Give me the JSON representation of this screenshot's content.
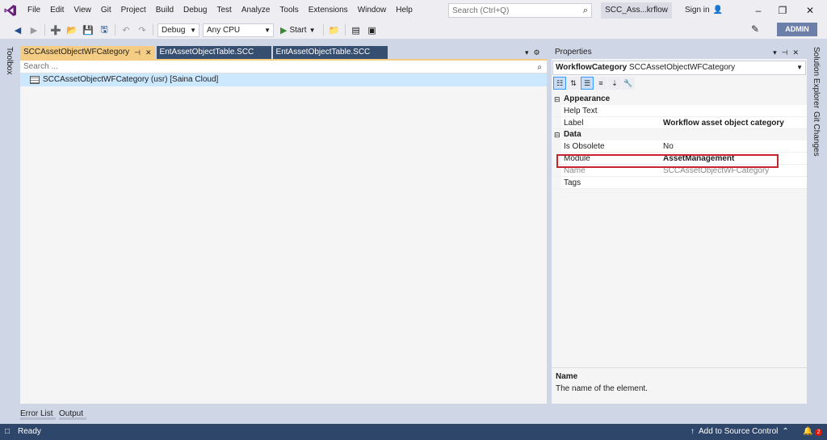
{
  "menubar": {
    "items": [
      "File",
      "Edit",
      "View",
      "Git",
      "Project",
      "Build",
      "Debug",
      "Test",
      "Analyze",
      "Tools",
      "Extensions",
      "Window",
      "Help"
    ],
    "search_placeholder": "Search (Ctrl+Q)",
    "solution_title": "SCC_Ass...krflow",
    "sign_in": "Sign in"
  },
  "toolbar": {
    "config": "Debug",
    "platform": "Any CPU",
    "start": "Start",
    "admin": "ADMIN"
  },
  "side": {
    "toolbox": "Toolbox",
    "solution_explorer": "Solution Explorer",
    "git_changes": "Git Changes"
  },
  "doc_tabs": [
    {
      "label": "SCCAssetObjectWFCategory",
      "active": true
    },
    {
      "label": "EntAssetObjectTable.SCC",
      "active": false
    },
    {
      "label": "EntAssetObjectTable.SCC",
      "active": false
    }
  ],
  "designer": {
    "search_placeholder": "Search ...",
    "tree_item": "SCCAssetObjectWFCategory (usr) [Saina Cloud]"
  },
  "properties": {
    "title": "Properties",
    "object_type": "WorkflowCategory",
    "object_name": "SCCAssetObjectWFCategory",
    "categories": [
      {
        "name": "Appearance",
        "rows": [
          {
            "key": "Help Text",
            "value": ""
          },
          {
            "key": "Label",
            "value": "Workflow asset object category"
          }
        ]
      },
      {
        "name": "Data",
        "rows": [
          {
            "key": "Is Obsolete",
            "value": "No"
          },
          {
            "key": "Module",
            "value": "AssetManagement"
          },
          {
            "key": "Name",
            "value": "SCCAssetObjectWFCategory"
          },
          {
            "key": "Tags",
            "value": ""
          }
        ]
      }
    ],
    "description_title": "Name",
    "description_text": "The name of the element."
  },
  "bottom_tabs": [
    "Error List",
    "Output"
  ],
  "status": {
    "ready": "Ready",
    "source_control": "Add to Source Control",
    "notification_count": "2"
  },
  "colors": {
    "accent_tab": "#f5cc84",
    "status_bar": "#2e4669",
    "highlight": "#c8242f"
  }
}
